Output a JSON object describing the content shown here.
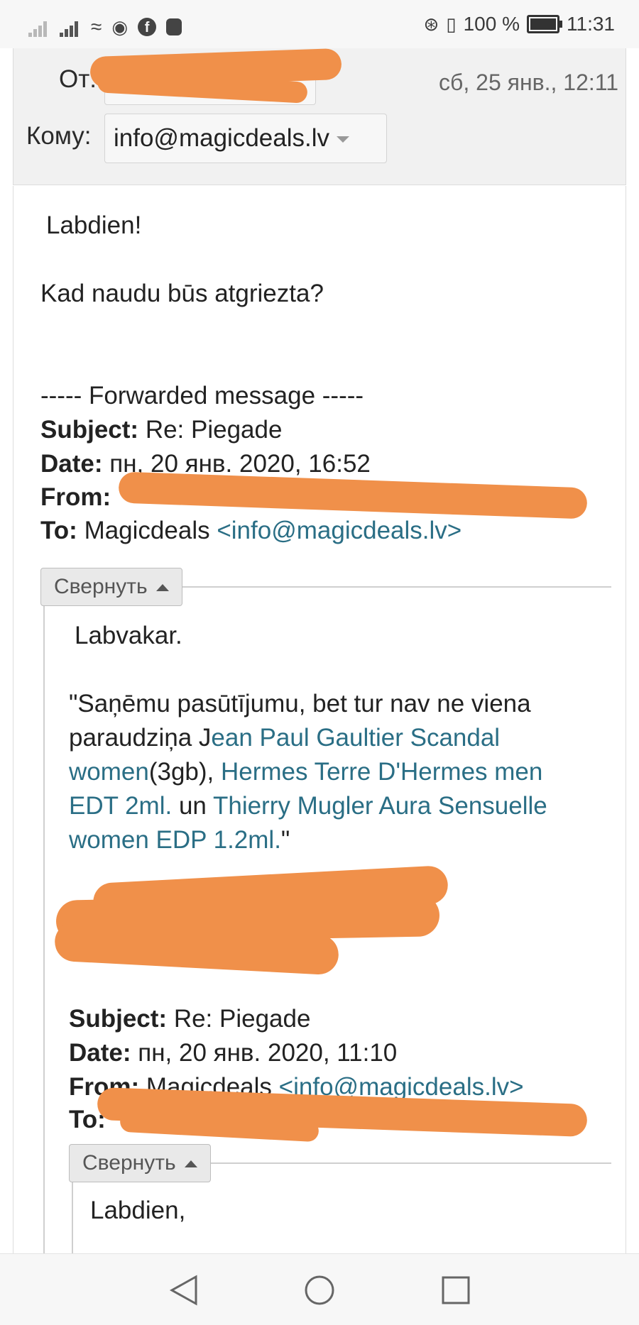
{
  "status_bar": {
    "battery": "100 %",
    "time": "11:31"
  },
  "header": {
    "from_label": "От:",
    "date": "сб, 25 янв., 12:11",
    "to_label": "Кому:",
    "to_value": "info@magicdeals.lv"
  },
  "body": {
    "greeting": "Labdien!",
    "question": "Kad naudu būs atgriezta?",
    "forward_marker": "----- Forwarded message -----",
    "fwd1": {
      "subject_label": "Subject:",
      "subject": "Re: Piegade",
      "date_label": "Date:",
      "date": "пн, 20 янв. 2020, 16:52",
      "from_label": "From:",
      "to_label": "To:",
      "to_name": "Magicdeals",
      "to_email": "<info@magicdeals.lv>"
    },
    "collapse_label": "Свернуть",
    "quote1": {
      "greeting": "Labvakar.",
      "line1": "\"Saņēmu pasūtījumu, bet tur nav ne viena",
      "line2_prefix": "paraudziņa J",
      "line2_link": "ean Paul Gaultier Scandal",
      "line3_link": "women",
      "line3_mid": "(3gb), ",
      "line3_link2": "Hermes Terre D'Hermes men",
      "line4_link": "EDT 2ml.",
      "line4_mid": " un ",
      "line4_link2": "Thierry Mugler Aura Sensuelle",
      "line5_link": "women EDP 1.2ml.",
      "line5_end": "\""
    },
    "fwd2": {
      "subject_label": "Subject:",
      "subject": "Re: Piegade",
      "date_label": "Date:",
      "date": "пн, 20 янв. 2020, 11:10",
      "from_label": "From:",
      "from_name": "Magicdeals",
      "from_email": "<info@magicdeals.lv>",
      "to_label": "To:"
    },
    "quote2": {
      "greeting": "Labdien,"
    }
  }
}
